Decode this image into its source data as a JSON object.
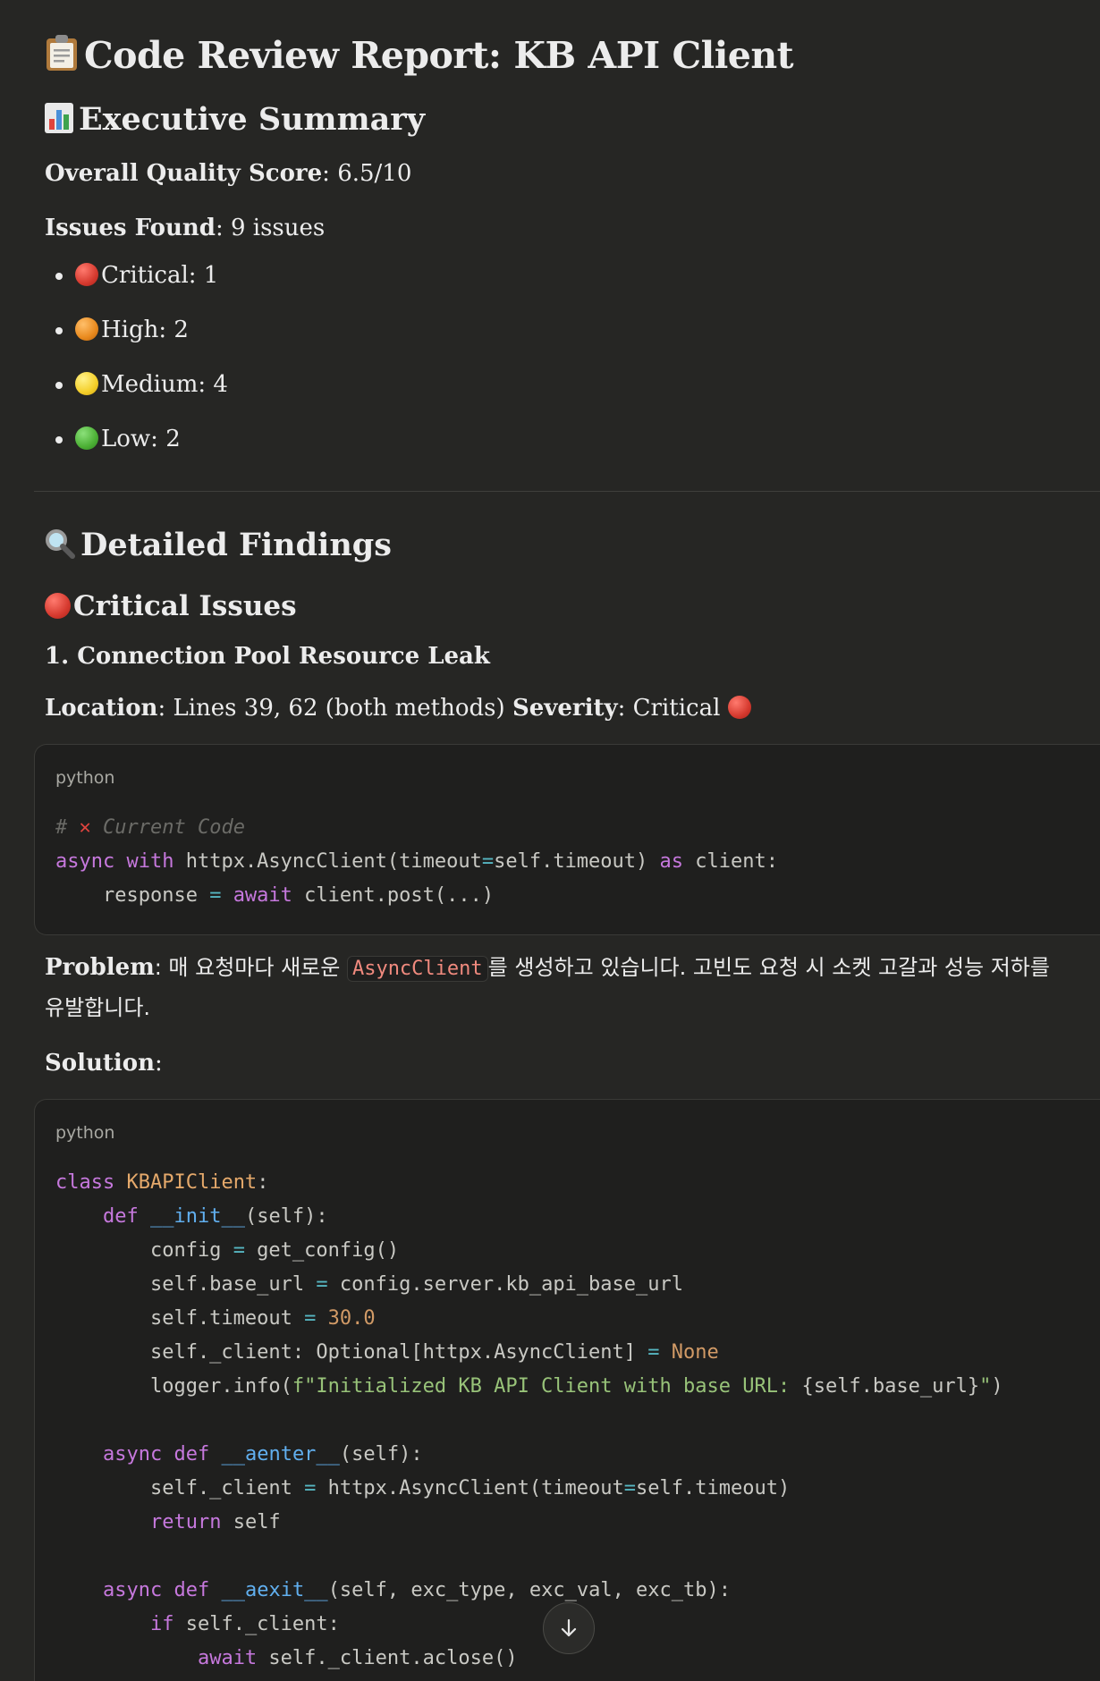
{
  "report": {
    "title": "Code Review Report: KB API Client",
    "title_icon": "clipboard-icon"
  },
  "summary": {
    "heading": "Executive Summary",
    "heading_icon": "bar-chart-icon",
    "quality_label": "Overall Quality Score",
    "quality_value": ": 6.5/10",
    "issues_label": "Issues Found",
    "issues_value": ": 9 issues",
    "severities": [
      {
        "label": "Critical: 1",
        "color": "#d63a2f",
        "icon": "red-circle-icon"
      },
      {
        "label": "High: 2",
        "color": "#e98a1e",
        "icon": "orange-circle-icon"
      },
      {
        "label": "Medium: 4",
        "color": "#f4cf2a",
        "icon": "yellow-circle-icon"
      },
      {
        "label": "Low: 2",
        "color": "#4cb035",
        "icon": "green-circle-icon"
      }
    ]
  },
  "findings": {
    "heading": "Detailed Findings",
    "heading_icon": "magnifier-icon",
    "critical_heading": "Critical Issues",
    "issue1": {
      "title": "1. Connection Pool Resource Leak",
      "location_label": "Location",
      "location_value": ": Lines 39, 62 (both methods) ",
      "severity_label": "Severity",
      "severity_value": ": Critical ",
      "code_lang": "python",
      "problem_label": "Problem",
      "problem_pre": ": 매 요청마다 새로운 ",
      "problem_code": "AsyncClient",
      "problem_post": "를 생성하고 있습니다. 고빈도 요청 시 소켓 고갈과 성능 저하를",
      "problem_line2": "유발합니다.",
      "solution_label": "Solution",
      "solution_suffix": ":",
      "solution_lang": "python"
    }
  },
  "colors": {
    "background": "#262624",
    "code_background": "#1f1f1e",
    "keyword": "#c678dd",
    "function": "#61afef",
    "class_name": "#e5a96b",
    "string": "#98c379"
  },
  "scroll_button_icon": "arrow-down-icon"
}
